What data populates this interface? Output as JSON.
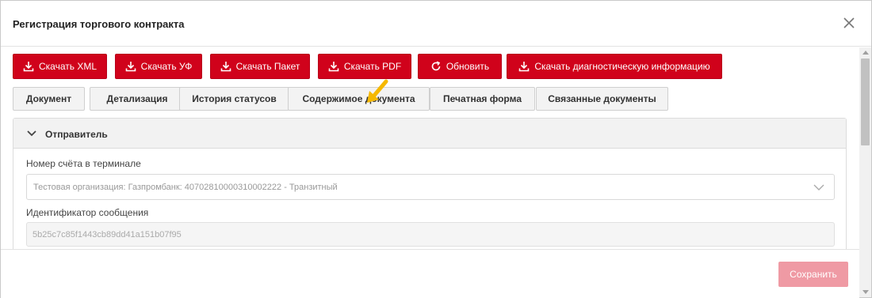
{
  "dialog": {
    "title": "Регистрация торгового контракта"
  },
  "toolbar": {
    "buttons": [
      {
        "label": "Скачать XML",
        "icon": "download-icon"
      },
      {
        "label": "Скачать УФ",
        "icon": "download-icon"
      },
      {
        "label": "Скачать Пакет",
        "icon": "download-icon"
      },
      {
        "label": "Скачать PDF",
        "icon": "download-icon"
      },
      {
        "label": "Обновить",
        "icon": "refresh-icon"
      },
      {
        "label": "Скачать диагностическую информацию",
        "icon": "download-icon"
      }
    ]
  },
  "tabs": [
    {
      "label": "Документ"
    },
    {
      "label": "Детализация"
    },
    {
      "label": "История статусов"
    },
    {
      "label": "Содержимое документа"
    },
    {
      "label": "Печатная форма"
    },
    {
      "label": "Связанные документы"
    }
  ],
  "section": {
    "title": "Отправитель",
    "account_label": "Номер счёта в терминале",
    "account_value": "Тестовая организация: Газпромбанк: 40702810000310002222 - Транзитный",
    "message_id_label": "Идентификатор сообщения",
    "message_id_value": "5b25c7c85f1443cb89dd41a151b07f95"
  },
  "footer": {
    "save_label": "Сохранить"
  },
  "colors": {
    "primary": "#d0021b",
    "primary_disabled": "#ef9aa4",
    "tab_bg": "#f3f3f3",
    "pointer": "#f5b800"
  }
}
